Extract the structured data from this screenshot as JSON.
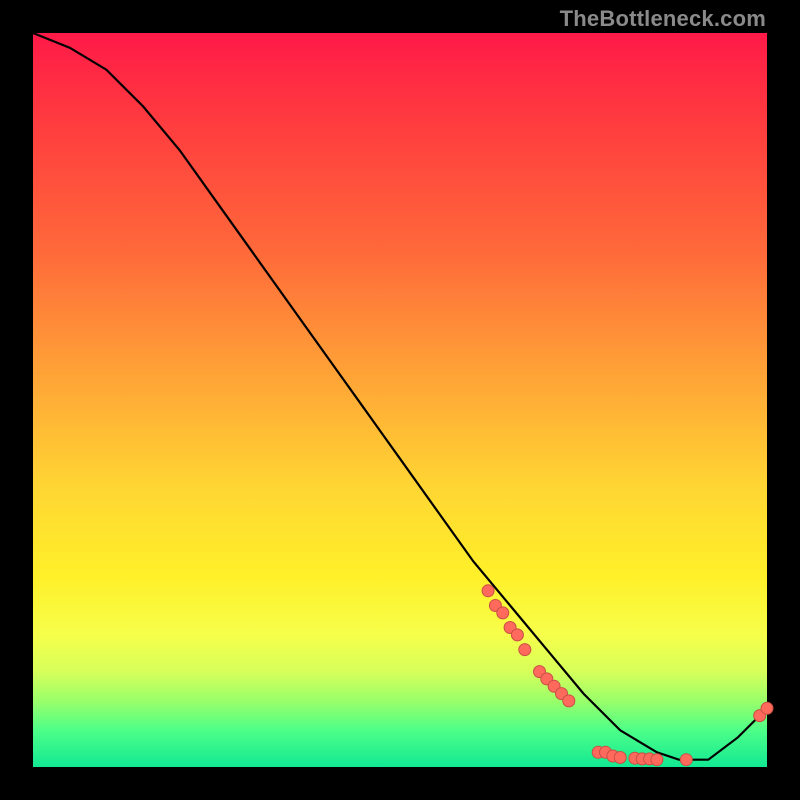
{
  "watermark": "TheBottleneck.com",
  "chart_data": {
    "type": "line",
    "title": "",
    "xlabel": "",
    "ylabel": "",
    "xlim": [
      0,
      100
    ],
    "ylim": [
      0,
      100
    ],
    "series": [
      {
        "name": "curve",
        "x": [
          0,
          5,
          10,
          15,
          20,
          25,
          30,
          35,
          40,
          45,
          50,
          55,
          60,
          65,
          70,
          75,
          80,
          85,
          88,
          92,
          96,
          100
        ],
        "y": [
          100,
          98,
          95,
          90,
          84,
          77,
          70,
          63,
          56,
          49,
          42,
          35,
          28,
          22,
          16,
          10,
          5,
          2,
          1,
          1,
          4,
          8
        ]
      }
    ],
    "markers": [
      {
        "x": 62,
        "y": 24
      },
      {
        "x": 63,
        "y": 22
      },
      {
        "x": 64,
        "y": 21
      },
      {
        "x": 65,
        "y": 19
      },
      {
        "x": 66,
        "y": 18
      },
      {
        "x": 67,
        "y": 16
      },
      {
        "x": 69,
        "y": 13
      },
      {
        "x": 70,
        "y": 12
      },
      {
        "x": 71,
        "y": 11
      },
      {
        "x": 72,
        "y": 10
      },
      {
        "x": 73,
        "y": 9
      },
      {
        "x": 77,
        "y": 2
      },
      {
        "x": 78,
        "y": 2
      },
      {
        "x": 79,
        "y": 1.5
      },
      {
        "x": 80,
        "y": 1.3
      },
      {
        "x": 82,
        "y": 1.2
      },
      {
        "x": 83,
        "y": 1.1
      },
      {
        "x": 84,
        "y": 1.1
      },
      {
        "x": 85,
        "y": 1
      },
      {
        "x": 89,
        "y": 1
      },
      {
        "x": 99,
        "y": 7
      },
      {
        "x": 100,
        "y": 8
      }
    ],
    "colors": {
      "curve": "#000000",
      "marker_fill": "#ff6a5c",
      "marker_stroke": "#c94f45"
    }
  }
}
